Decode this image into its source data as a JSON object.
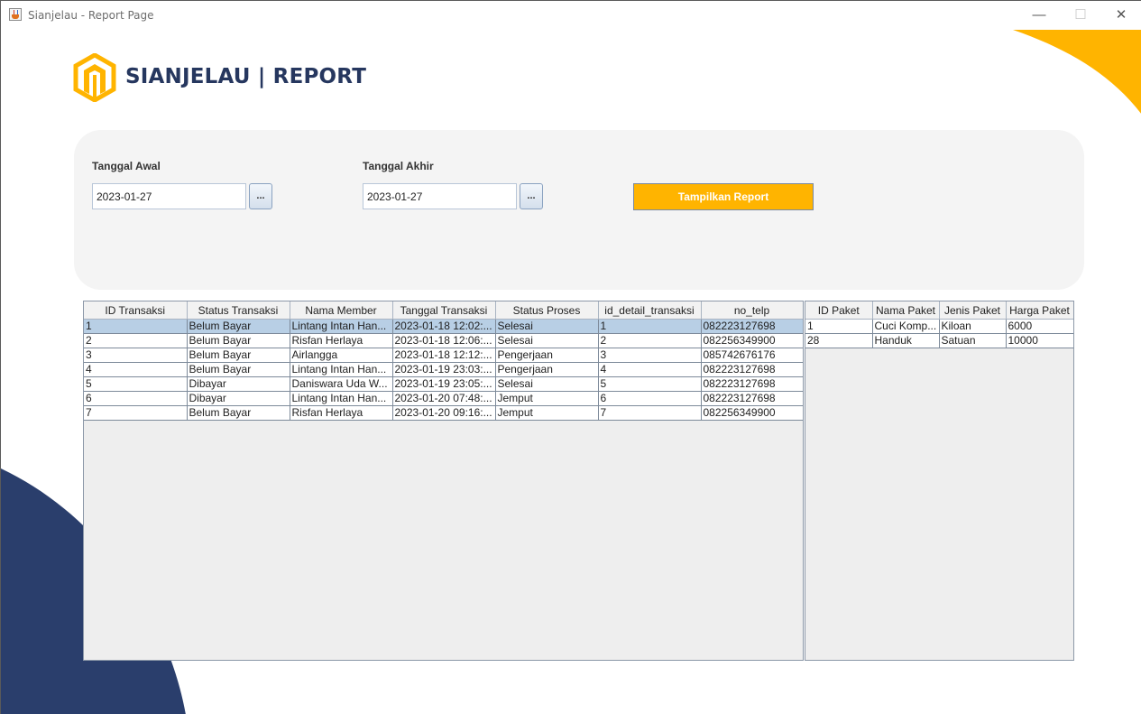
{
  "window": {
    "title": "Sianjelau - Report Page",
    "controls": {
      "minimize": "—",
      "maximize": "☐",
      "close": "✕"
    }
  },
  "brand": {
    "logo_text": "SIANJELAU | REPORT",
    "colors": {
      "navy": "#2a3e6c",
      "yellow": "#ffb400"
    }
  },
  "filters": {
    "start_label": "Tanggal Awal",
    "start_value": "2023-01-27",
    "end_label": "Tanggal Akhir",
    "end_value": "2023-01-27",
    "picker_label": "...",
    "submit_label": "Tampilkan Report"
  },
  "transactions_table": {
    "columns": [
      "ID Transaksi",
      "Status Transaksi",
      "Nama Member",
      "Tanggal Transaksi",
      "Status Proses",
      "id_detail_transaksi",
      "no_telp"
    ],
    "rows": [
      [
        "1",
        "Belum Bayar",
        "Lintang Intan Han...",
        "2023-01-18 12:02:...",
        "Selesai",
        "1",
        "082223127698"
      ],
      [
        "2",
        "Belum Bayar",
        "Risfan Herlaya",
        "2023-01-18 12:06:...",
        "Selesai",
        "2",
        "082256349900"
      ],
      [
        "3",
        "Belum Bayar",
        "Airlangga",
        "2023-01-18 12:12:...",
        "Pengerjaan",
        "3",
        "085742676176"
      ],
      [
        "4",
        "Belum Bayar",
        "Lintang Intan Han...",
        "2023-01-19 23:03:...",
        "Pengerjaan",
        "4",
        "082223127698"
      ],
      [
        "5",
        "Dibayar",
        "Daniswara Uda W...",
        "2023-01-19 23:05:...",
        "Selesai",
        "5",
        "082223127698"
      ],
      [
        "6",
        "Dibayar",
        "Lintang Intan Han...",
        "2023-01-20 07:48:...",
        "Jemput",
        "6",
        "082223127698"
      ],
      [
        "7",
        "Belum Bayar",
        "Risfan Herlaya",
        "2023-01-20 09:16:...",
        "Jemput",
        "7",
        "082256349900"
      ]
    ],
    "selected_row": 0
  },
  "packages_table": {
    "columns": [
      "ID Paket",
      "Nama Paket",
      "Jenis Paket",
      "Harga Paket"
    ],
    "rows": [
      [
        "1",
        "Cuci Komp...",
        "Kiloan",
        "6000"
      ],
      [
        "28",
        "Handuk",
        "Satuan",
        "10000"
      ]
    ]
  }
}
